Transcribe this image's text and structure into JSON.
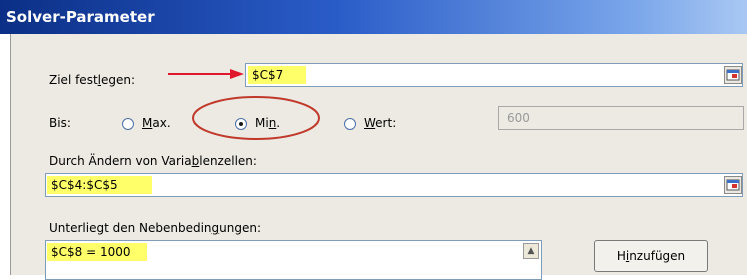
{
  "window": {
    "title": "Solver-Parameter"
  },
  "objective": {
    "label": "Ziel festlegen:",
    "value": "$C$7"
  },
  "to": {
    "label": "Bis:",
    "options": [
      {
        "key": "max",
        "label": "Max.",
        "selected": false
      },
      {
        "key": "min",
        "label": "Min.",
        "selected": true
      },
      {
        "key": "value",
        "label": "Wert:",
        "selected": false
      }
    ],
    "value_field": "600"
  },
  "variables": {
    "label": "Durch Ändern von Variablenzellen:",
    "value": "$C$4:$C$5"
  },
  "constraints": {
    "label": "Unterliegt den Nebenbedingungen:",
    "items": [
      "$C$8 = 1000"
    ]
  },
  "buttons": {
    "add_label": "Hinzufügen"
  },
  "annotation_colors": {
    "arrow": "#e0182b",
    "ellipse": "#c0392b",
    "highlight": "#ffff6a"
  }
}
